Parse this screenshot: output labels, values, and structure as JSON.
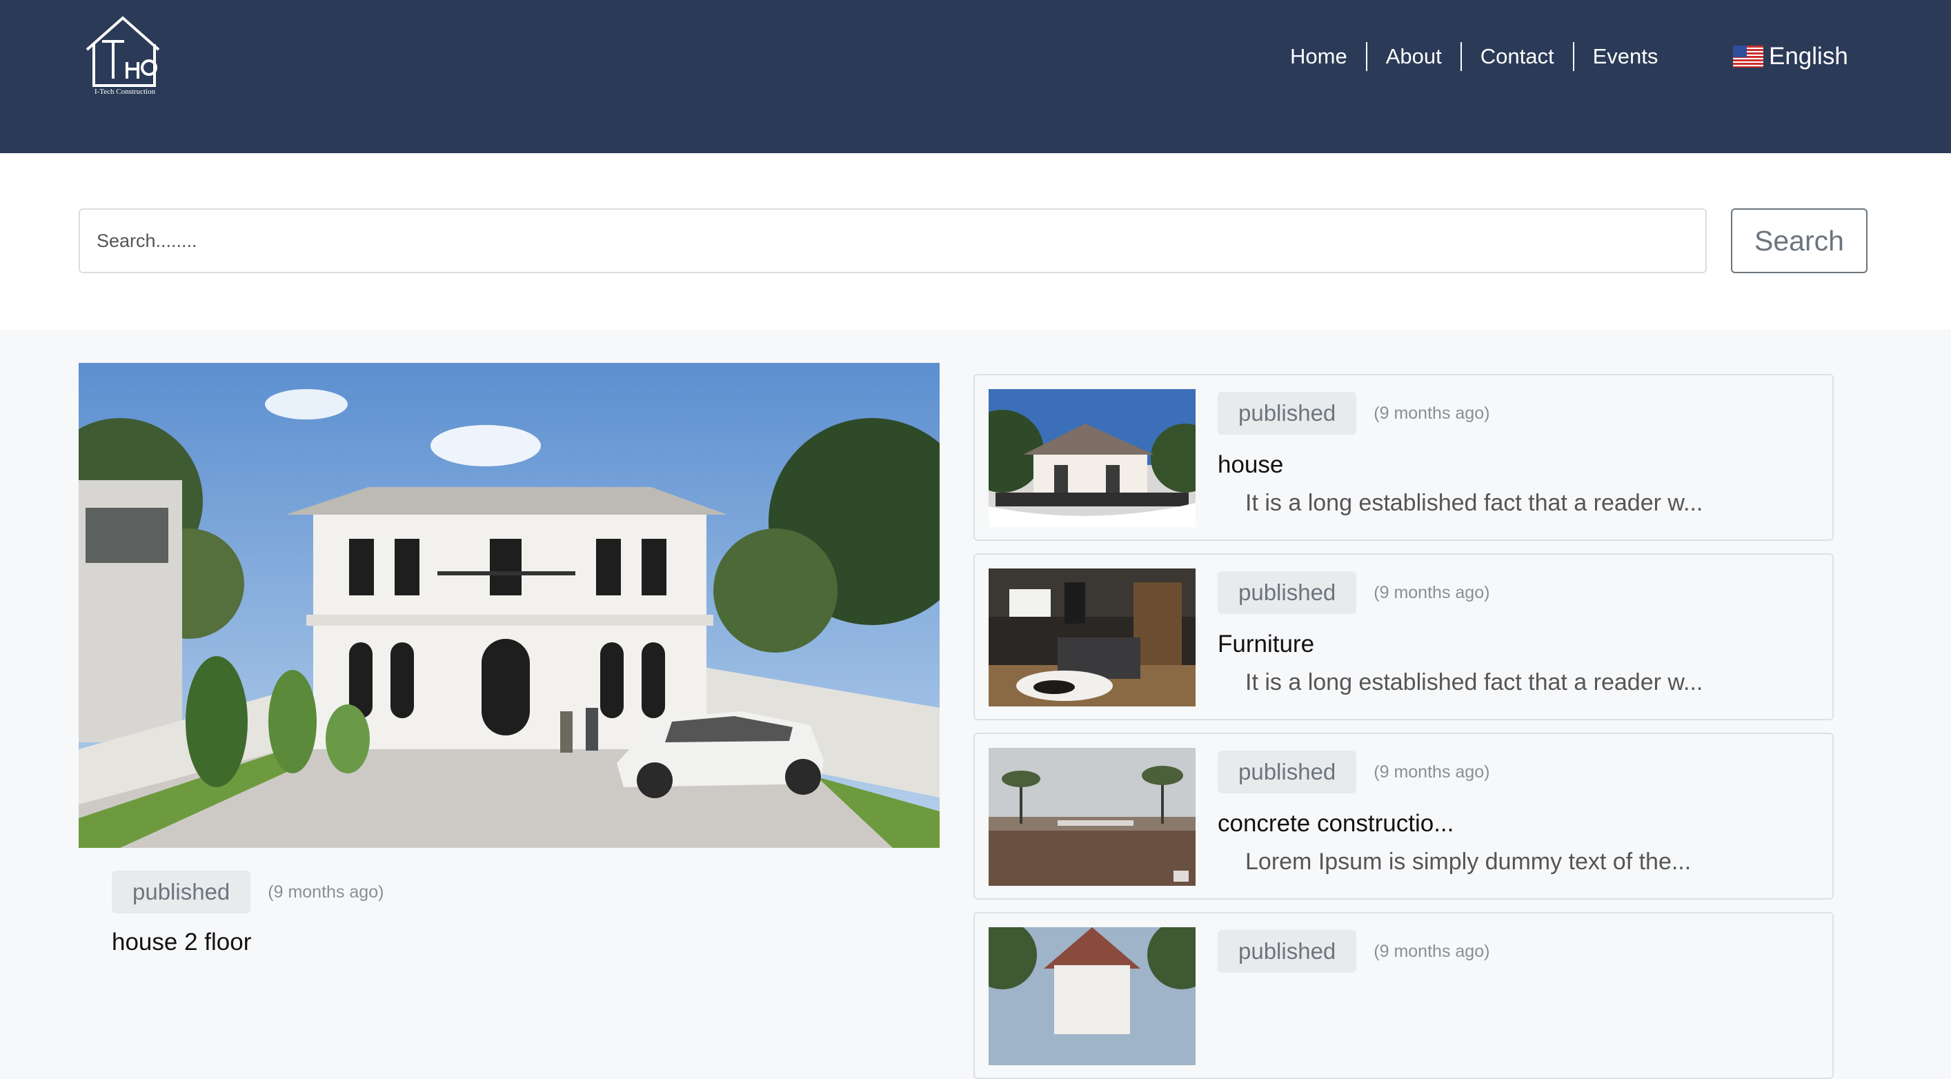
{
  "header": {
    "logo_text": "I-Tech Construction",
    "nav": [
      "Home",
      "About",
      "Contact",
      "Events"
    ],
    "language": "English",
    "language_flag": "us-flag-icon"
  },
  "search": {
    "placeholder": "Search........",
    "button_label": "Search"
  },
  "featured": {
    "status": "published",
    "time_ago": "(9 months ago)",
    "title": "house 2 floor"
  },
  "posts": [
    {
      "status": "published",
      "time_ago": "(9 months ago)",
      "title": "house",
      "excerpt": "It is a long established fact that a reader w..."
    },
    {
      "status": "published",
      "time_ago": "(9 months ago)",
      "title": "Furniture",
      "excerpt": "It is a long established fact that a reader w..."
    },
    {
      "status": "published",
      "time_ago": "(9 months ago)",
      "title": "concrete constructio...",
      "excerpt": "Lorem Ipsum is simply dummy text of the..."
    },
    {
      "status": "published",
      "time_ago": "(9 months ago)",
      "title": "",
      "excerpt": ""
    }
  ],
  "colors": {
    "header_bg": "#2b3a57",
    "page_bg": "#f7f8fa",
    "badge_bg": "#e9eaec",
    "badge_text": "#6c757d"
  }
}
